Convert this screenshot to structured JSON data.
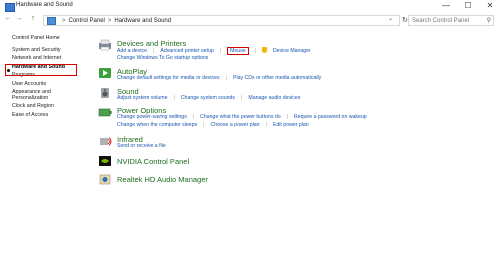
{
  "window": {
    "title": "Hardware and Sound"
  },
  "window_controls": [
    "—",
    "☐",
    "✕"
  ],
  "nav": {
    "back": "←",
    "forward": "→",
    "up": "↑",
    "dropdown": "⌄",
    "refresh": "↻"
  },
  "address": {
    "root": "Control Panel",
    "current": "Hardware and Sound",
    "separator": ">"
  },
  "search": {
    "placeholder": "Search Control Panel",
    "icon": "search-icon"
  },
  "sidebar": {
    "home": "Control Panel Home",
    "items": [
      "System and Security",
      "Network and Internet",
      "Hardware and Sound",
      "Programs",
      "User Accounts",
      "Appearance and Personalization",
      "Clock and Region",
      "Ease of Access"
    ],
    "active_index": 2
  },
  "categories": {
    "devices": {
      "title": "Devices and Printers",
      "row1": [
        "Add a device",
        "Advanced printer setup",
        "Mouse",
        "Device Manager"
      ],
      "row2": [
        "Change Windows To Go startup options"
      ]
    },
    "autoplay": {
      "title": "AutoPlay",
      "row1": [
        "Change default settings for media or devices",
        "Play CDs or other media automatically"
      ]
    },
    "sound": {
      "title": "Sound",
      "row1": [
        "Adjust system volume",
        "Change system sounds",
        "Manage audio devices"
      ]
    },
    "power": {
      "title": "Power Options",
      "row1": [
        "Change power-saving settings",
        "Change what the power buttons do",
        "Require a password on wakeup"
      ],
      "row2": [
        "Change when the computer sleeps",
        "Choose a power plan",
        "Edit power plan"
      ]
    },
    "infrared": {
      "title": "Infrared",
      "row1": [
        "Send or receive a file"
      ]
    },
    "nvidia": {
      "title": "NVIDIA Control Panel"
    },
    "realtek": {
      "title": "Realtek HD Audio Manager"
    }
  },
  "colors": {
    "link": "#1a56b0",
    "heading": "#1e6e1e",
    "highlight": "#d40000"
  }
}
